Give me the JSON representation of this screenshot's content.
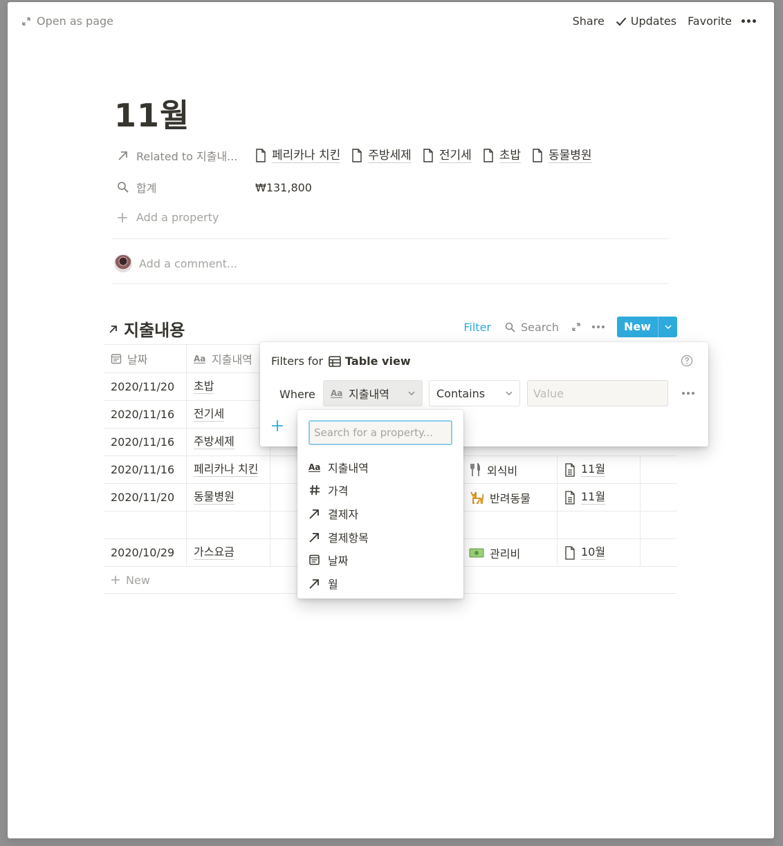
{
  "topbar": {
    "open_as_page": "Open as page",
    "share": "Share",
    "updates": "Updates",
    "favorite": "Favorite"
  },
  "page": {
    "title": "11월",
    "properties": {
      "related_label": "Related to 지출내...",
      "related_items": [
        "페리카나 치킨",
        "주방세제",
        "전기세",
        "초밥",
        "동물병원"
      ],
      "sum_label": "합계",
      "sum_value": "₩131,800",
      "add_property": "Add a property"
    },
    "comment_placeholder": "Add a comment..."
  },
  "database": {
    "title": "지출내용",
    "filter": "Filter",
    "search": "Search",
    "new": "New",
    "columns": {
      "date": "날짜",
      "name": "지출내역"
    },
    "rows": [
      {
        "date": "2020/11/20",
        "name": "초밥",
        "category": "",
        "month": ""
      },
      {
        "date": "2020/11/16",
        "name": "전기세",
        "category": "",
        "month": ""
      },
      {
        "date": "2020/11/16",
        "name": "주방세제",
        "category": "",
        "month": ""
      },
      {
        "date": "2020/11/16",
        "name": "페리카나 치킨",
        "category": "외식비",
        "month": "11월"
      },
      {
        "date": "2020/11/20",
        "name": "동물병원",
        "category": "반려동물",
        "month": "11월"
      },
      {
        "date": "",
        "name": "",
        "category": "",
        "month": ""
      },
      {
        "date": "2020/10/29",
        "name": "가스요금",
        "category": "관리비",
        "month": "10월"
      }
    ],
    "new_row": "New"
  },
  "filter_panel": {
    "filters_for": "Filters for",
    "view_name": "Table view",
    "where": "Where",
    "property": "지출내역",
    "operator": "Contains",
    "value_placeholder": "Value"
  },
  "property_dropdown": {
    "search_placeholder": "Search for a property...",
    "items": [
      {
        "label": "지출내역",
        "icon": "text-aa-icon"
      },
      {
        "label": "가격",
        "icon": "hash-icon"
      },
      {
        "label": "결제자",
        "icon": "arrow-up-right-icon"
      },
      {
        "label": "결제항목",
        "icon": "arrow-up-right-icon"
      },
      {
        "label": "날짜",
        "icon": "calendar-icon"
      },
      {
        "label": "월",
        "icon": "arrow-up-right-icon"
      }
    ]
  },
  "colors": {
    "accent": "#2eaadc",
    "text": "#37352f",
    "muted": "#8b8a86"
  }
}
